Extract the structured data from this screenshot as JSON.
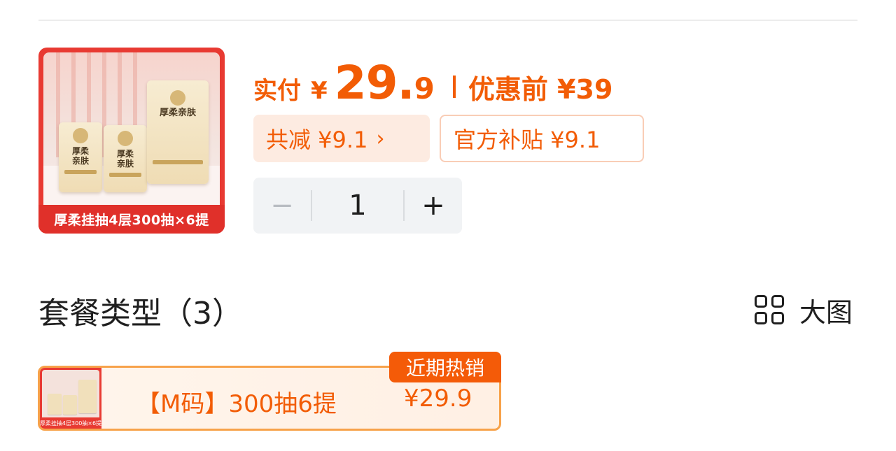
{
  "product": {
    "image_caption": "厚柔挂抽4层300抽×6提",
    "pack_text": "厚柔亲肤"
  },
  "price": {
    "paid_label": "实付",
    "currency": "¥",
    "paid_integer": "29.",
    "paid_decimal": "9",
    "original": "优惠前 ¥39"
  },
  "discounts": {
    "total": "共减 ¥9.1",
    "total_chevron": "›",
    "subsidy": "官方补贴 ¥9.1"
  },
  "quantity": {
    "minus": "−",
    "value": "1",
    "plus": "+"
  },
  "packages": {
    "title": "套餐类型（3）",
    "view_label": "大图",
    "options": [
      {
        "badge": "近期热销",
        "label": "【M码】300抽6提",
        "price": "¥29.9",
        "thumb_caption": "厚柔挂抽4层300抽×6提"
      }
    ]
  },
  "colors": {
    "accent": "#f25c05",
    "chip_bg": "#fdebe1",
    "image_red": "#e0302a",
    "stepper_bg": "#f1f3f5"
  }
}
